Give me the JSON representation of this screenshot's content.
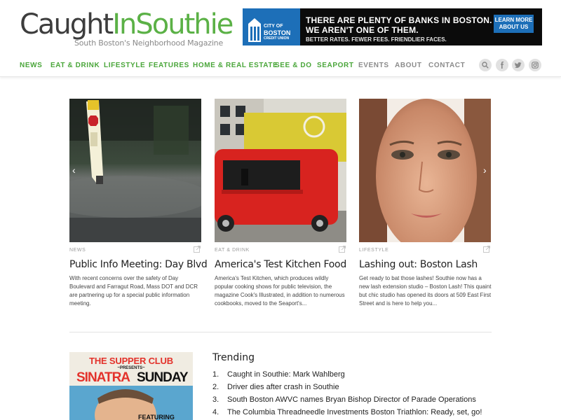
{
  "header": {
    "logo_part1": "Caught",
    "logo_part2": "In",
    "logo_part3": "Southie",
    "tagline": "South Boston's Neighborhood Magazine"
  },
  "ad": {
    "brand_line1": "CITY OF",
    "brand_line2": "BOSTON",
    "brand_line3": "CREDIT UNION",
    "headline1": "THERE ARE PLENTY OF BANKS IN BOSTON.",
    "headline2": "WE AREN'T ONE OF THEM.",
    "subline": "BETTER RATES. FEWER FEES. FRIENDLIER FACES.",
    "button_line1": "LEARN MORE",
    "button_line2": "ABOUT US"
  },
  "nav": {
    "items": [
      "NEWS",
      "EAT & DRINK",
      "LIFESTYLE",
      "FEATURES",
      "HOME & REAL ESTATE",
      "SEE & DO",
      "SEAPORT",
      "EVENTS",
      "ABOUT",
      "CONTACT"
    ],
    "icons": [
      "search-icon",
      "facebook-icon",
      "twitter-icon",
      "instagram-icon"
    ]
  },
  "cards": [
    {
      "category": "NEWS",
      "title": "Public Info Meeting: Day Blvd",
      "excerpt": "With recent concerns over the safety of Day Boulevard and Farragut Road, Mass DOT and DCR are partnering up for a special public information meeting."
    },
    {
      "category": "EAT & DRINK",
      "title": "America's Test Kitchen Food",
      "excerpt": "America's Test Kitchen, which produces wildly popular cooking shows for public television, the magazine Cook's Illustrated, in addition to numerous cookbooks, moved to the Seaport's..."
    },
    {
      "category": "LIFESTYLE",
      "title": "Lashing out: Boston Lash",
      "excerpt": "Get ready to bat those lashes! Southie now has a new lash extension studio – Boston Lash! This quaint but chic studio has opened its doors at 509 East First Street and is here to help you..."
    }
  ],
  "slider": {
    "prev": "‹",
    "next": "›"
  },
  "poster": {
    "title": "THE SUPPER CLUB",
    "presents": "~PRESENTS~",
    "word1": "SINATRA",
    "word2": "SUNDAY",
    "featuring": "FEATURING"
  },
  "trending": {
    "title": "Trending",
    "items": [
      {
        "num": "1.",
        "text": "Caught in Southie: Mark Wahlberg"
      },
      {
        "num": "2.",
        "text": "Driver dies after crash in Southie"
      },
      {
        "num": "3.",
        "text": "South Boston AWVC names Bryan Bishop Director of Parade Operations"
      },
      {
        "num": "4.",
        "text": "The Columbia Threadneedle Investments Boston Triathlon: Ready, set, go!"
      }
    ]
  },
  "colors": {
    "brand_green": "#5bb146",
    "nav_green": "#4aa63a",
    "nav_grey": "#8b8b8b",
    "ad_blue": "#1d6fb8"
  }
}
